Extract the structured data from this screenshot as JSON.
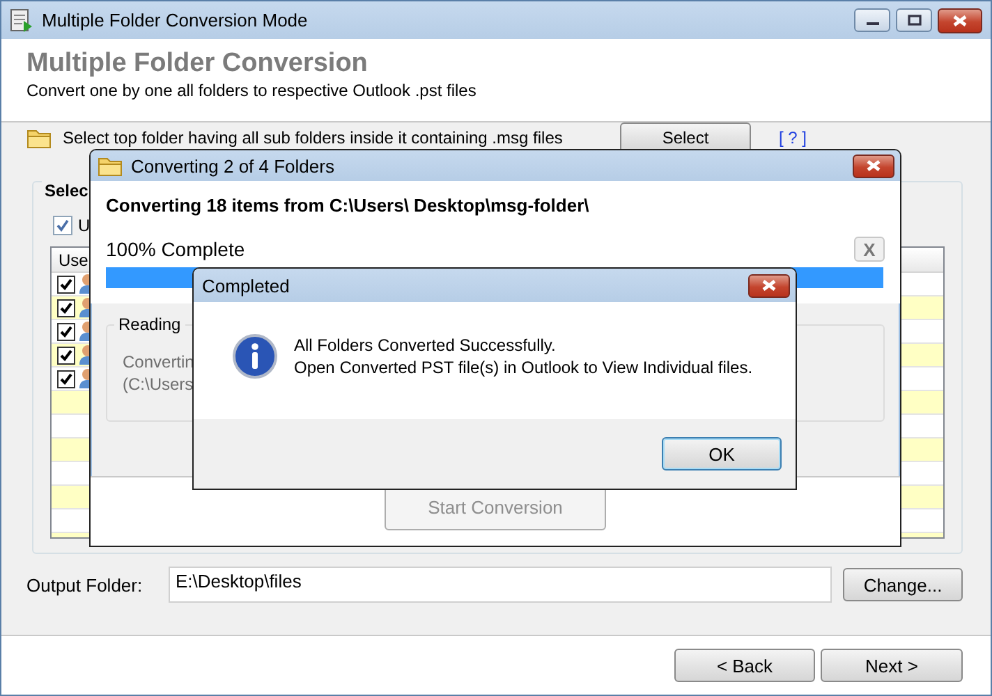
{
  "window": {
    "title": "Multiple Folder Conversion Mode"
  },
  "header": {
    "title": "Multiple Folder Conversion",
    "subtitle": "Convert one by one all folders to respective Outlook .pst files"
  },
  "source": {
    "label": "Select top folder having all sub folders inside it containing .msg files",
    "button": "Select",
    "help_link": "[ ? ]"
  },
  "selection_group": {
    "title": "Selec",
    "checkbox": {
      "label": "U",
      "checked": true
    },
    "table": {
      "columns": [
        "Use"
      ],
      "rows": [
        {
          "checked": true
        },
        {
          "checked": true
        },
        {
          "checked": true
        },
        {
          "checked": true
        },
        {
          "checked": true
        }
      ]
    }
  },
  "output": {
    "label": "Output Folder:",
    "value": "E:\\Desktop\\files",
    "button": "Change..."
  },
  "buttons": [
    "< Back",
    "Next >"
  ],
  "progress_dialog": {
    "title": "Converting 2 of 4 Folders",
    "heading": "Converting 18 items from C:\\Users\\ Desktop\\msg-folder\\",
    "cancel": "X",
    "percent": "100% Complete",
    "level": 1,
    "group": {
      "title": "Reading",
      "lines": [
        "Convertin",
        "(C:\\Users"
      ]
    },
    "start_button": {
      "label": "Start Conversion",
      "disabled": true
    }
  },
  "message_dialog": {
    "title": "Completed",
    "lines": [
      "All Folders Converted Successfully.",
      "Open Converted PST file(s) in Outlook to View Individual files."
    ],
    "button": "OK"
  }
}
